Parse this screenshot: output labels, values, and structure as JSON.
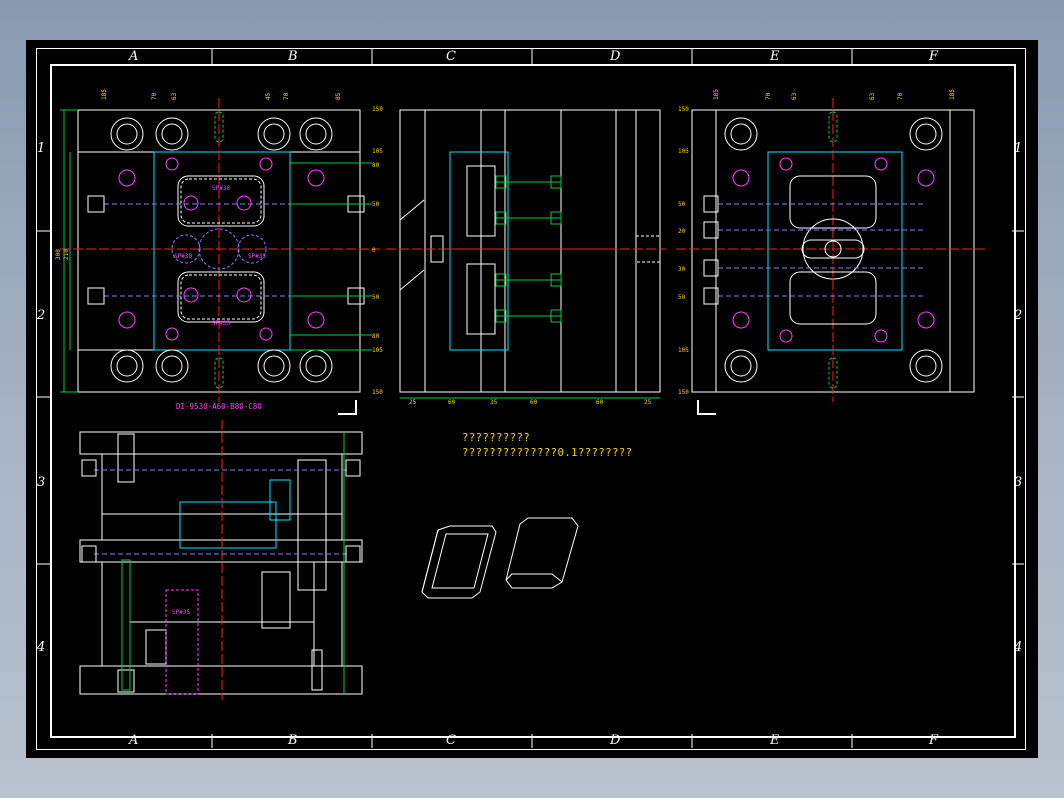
{
  "drawing": {
    "zone_columns": [
      "A",
      "B",
      "C",
      "D",
      "E",
      "F"
    ],
    "zone_rows": [
      "1",
      "2",
      "3",
      "4"
    ],
    "part_code": "DI-9530-A60-B80-C80",
    "notes": [
      "??????????",
      "??????????????0.1????????"
    ],
    "sprue_labels": [
      "SP#38",
      "SP#35",
      "SP#30",
      "SP#35"
    ],
    "top_dims_left": [
      "185",
      "70",
      "63",
      "45",
      "70",
      "85"
    ],
    "top_dims_right": [
      "185",
      "70",
      "63",
      "63",
      "70",
      "185"
    ],
    "side_dims_left": [
      "150",
      "105",
      "80",
      "50",
      "0",
      "50",
      "80",
      "105",
      "150"
    ],
    "side_dims_right": [
      "150",
      "105",
      "50",
      "20",
      "30",
      "50",
      "105",
      "150"
    ],
    "section_bottom_dims": [
      "25",
      "60",
      "35",
      "60",
      "60",
      "25"
    ],
    "overall_dims": [
      "300",
      "210"
    ],
    "colors": {
      "background": "#000000",
      "frame": "#ffffff",
      "centerline": "#ff2020",
      "dimension": "#ffd400",
      "cavity": "#00e5ff",
      "hidden": "#8080ff",
      "label": "#ff40ff",
      "outline": "#ffffff",
      "dim_line": "#00cc44"
    }
  }
}
